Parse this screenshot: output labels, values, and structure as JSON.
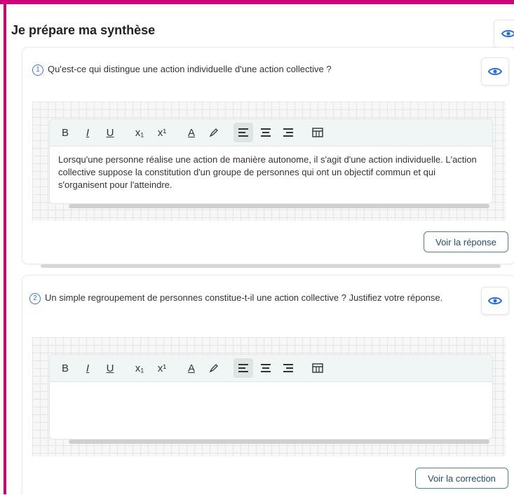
{
  "section": {
    "title": "Je prépare ma synthèse"
  },
  "questions": [
    {
      "number": "1",
      "text": "Qu'est-ce qui distingue une action individuelle d'une action collective ?",
      "answer": "Lorsqu'une personne réalise une action de manière autonome, il s'agit d'une action individuelle. L'action collective suppose la constitution d'un groupe de personnes qui ont un objectif commun et qui s'organisent pour l'atteindre.",
      "button_label": "Voir la réponse"
    },
    {
      "number": "2",
      "text": "Un simple regroupement de personnes constitue-t-il une action collective ? Justifiez votre réponse.",
      "answer": "",
      "button_label": "Voir la correction"
    }
  ],
  "toolbar": {
    "bold": "B",
    "italic": "I",
    "underline": "U",
    "subscript": "x₁",
    "superscript": "x¹",
    "font_color": "A",
    "highlight_icon": "highlighter-icon",
    "align_left_icon": "align-left-icon",
    "align_center_icon": "align-center-icon",
    "align_right_icon": "align-right-icon",
    "table_icon": "table-icon"
  },
  "colors": {
    "frame": "#d1007a",
    "accent": "#3a73d8",
    "button_border": "#4a7fa0"
  }
}
